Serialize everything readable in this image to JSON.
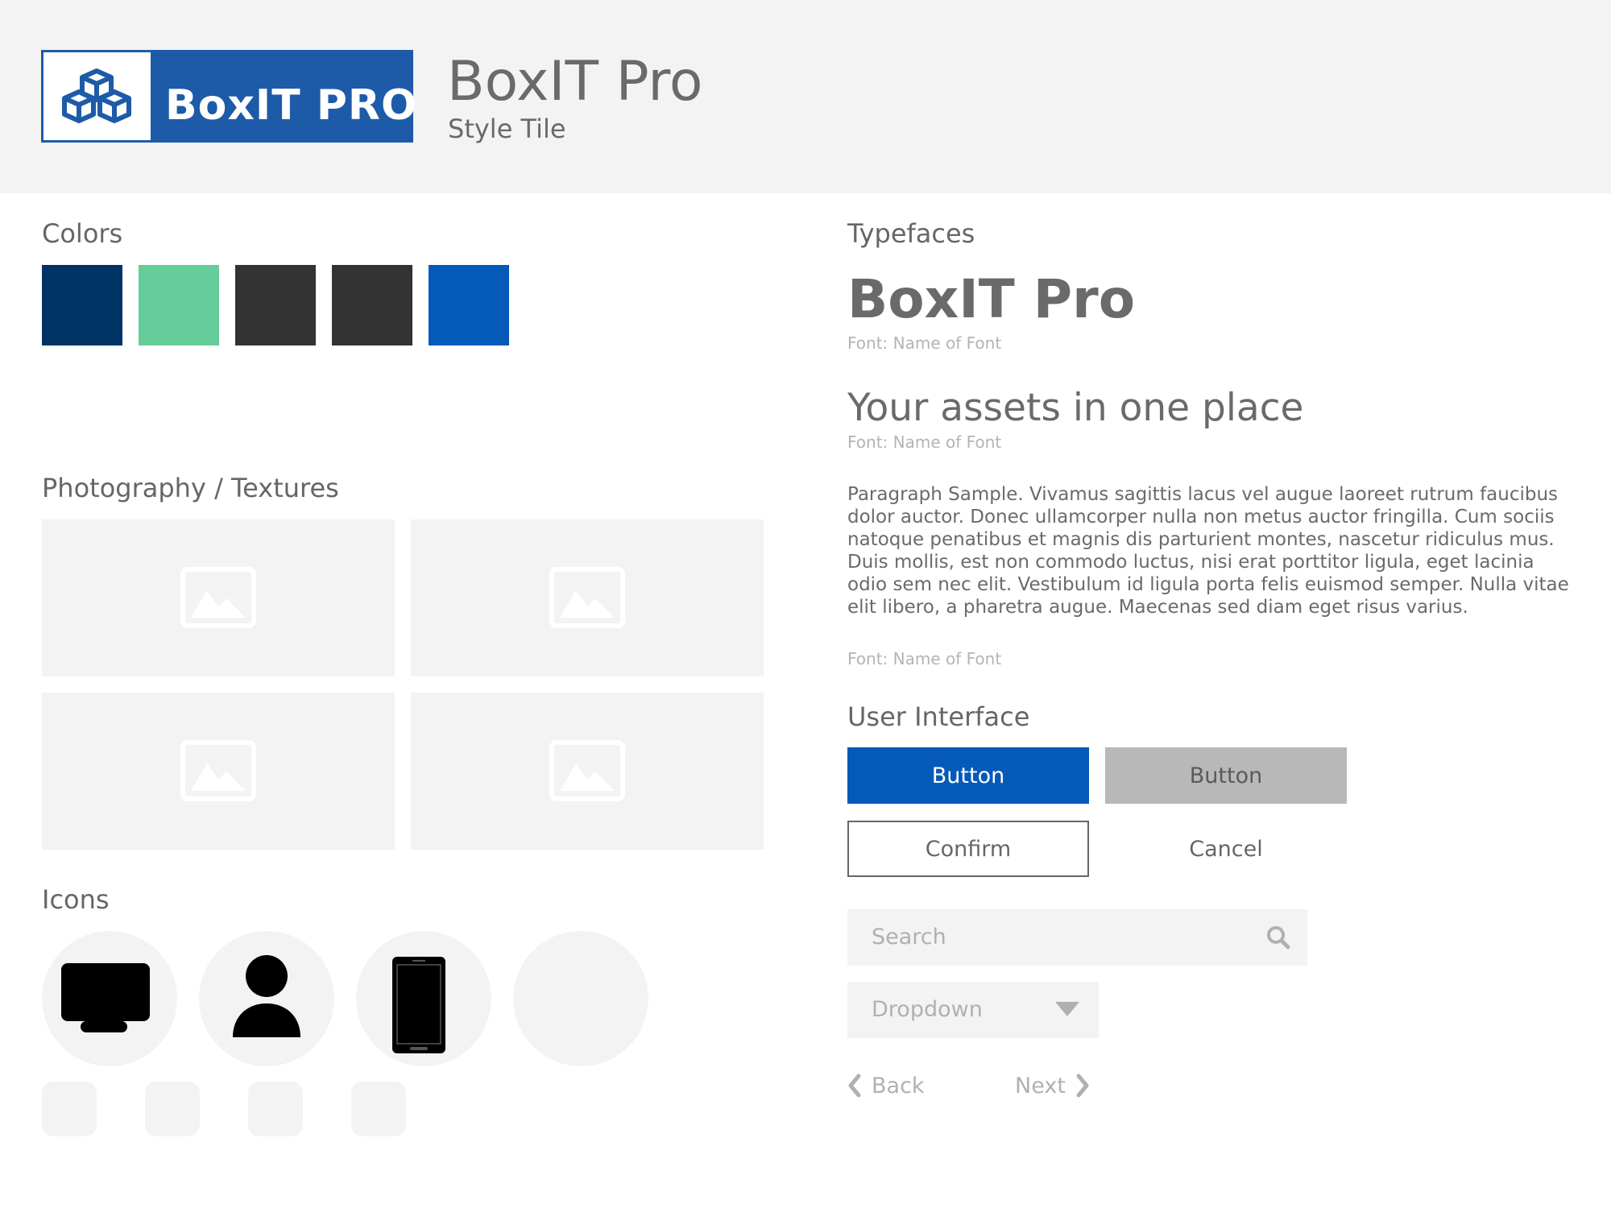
{
  "header": {
    "logo_text": "BoxIT PRO",
    "title": "BoxIT Pro",
    "subtitle": "Style Tile"
  },
  "colors_section": {
    "title": "Colors",
    "swatches": [
      "#003366",
      "#66cc99",
      "#333333",
      "#333333",
      "#0459b9"
    ]
  },
  "photography_section": {
    "title": "Photography / Textures",
    "placeholders": [
      "image-placeholder-icon",
      "image-placeholder-icon",
      "image-placeholder-icon",
      "image-placeholder-icon"
    ]
  },
  "icons_section": {
    "title": "Icons",
    "icons": [
      "monitor-icon",
      "user-icon",
      "smartphone-icon",
      ""
    ]
  },
  "typefaces_section": {
    "title": "Typefaces",
    "heading_sample": "BoxIT Pro",
    "heading_font_note": "Font: Name of Font",
    "subheading_sample": "Your assets in one place",
    "subheading_font_note": "Font: Name of Font",
    "paragraph_sample": "Paragraph Sample. Vivamus sagittis lacus vel augue laoreet rutrum faucibus dolor auctor. Donec ullamcorper nulla non metus auctor fringilla. Cum sociis natoque penatibus et magnis dis parturient montes, nascetur ridiculus mus. Duis mollis, est non commodo luctus, nisi erat porttitor ligula, eget lacinia odio sem nec elit. Vestibulum id ligula porta felis euismod semper. Nulla vitae elit libero, a pharetra augue. Maecenas sed diam eget risus varius.",
    "paragraph_font_note": "Font: Name of Font"
  },
  "ui_section": {
    "title": "User Interface",
    "primary_button": "Button",
    "secondary_button": "Button",
    "confirm_button": "Confirm",
    "cancel_button": "Cancel",
    "search_placeholder": "Search",
    "dropdown_label": "Dropdown",
    "back_label": "Back",
    "next_label": "Next",
    "colors": {
      "primary": "#0459b9",
      "secondary": "#b8b8b8"
    }
  }
}
